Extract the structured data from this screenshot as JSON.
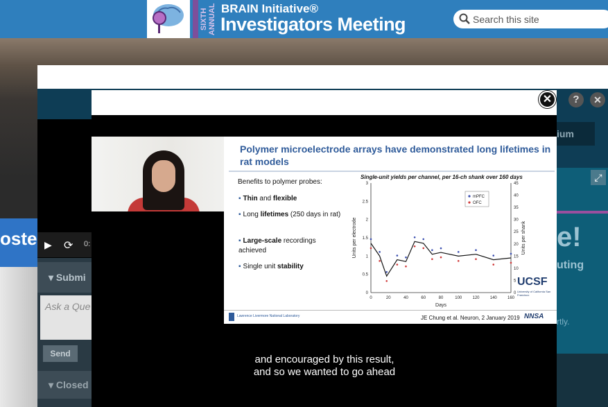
{
  "header": {
    "logo_year": "SIXTH ANNUAL",
    "logo_top": "BRAIN Initiative®",
    "logo_main": "Investigators Meeting",
    "search_placeholder": "Search this site"
  },
  "background": {
    "poster_sign": "oster"
  },
  "panel": {
    "time_label": "0:",
    "submit_label": "Submi",
    "ask_placeholder": "Ask a Que",
    "send_label": "Send",
    "closed_label": "Closed",
    "help_label": "?",
    "close_label": "✕",
    "right_button_label": "ium",
    "right_heading": "e!",
    "right_word": "uting",
    "right_small": "rtly.",
    "expand_label": "⤢"
  },
  "video": {
    "close_label": "✕",
    "slide": {
      "title": "Polymer microelectrode arrays have demonstrated long lifetimes in rat models",
      "benefits_title": "Benefits to polymer probes:",
      "bullets": [
        {
          "bold1": "Thin",
          "mid": " and ",
          "bold2": "flexible",
          "rest": ""
        },
        {
          "bold1": "",
          "mid": "Long ",
          "bold2": "lifetimes",
          "rest": " (250 days in rat)"
        },
        {
          "bold1": "Large-scale",
          "mid": " recordings achieved",
          "bold2": "",
          "rest": ""
        },
        {
          "bold1": "",
          "mid": "Single unit ",
          "bold2": "stability",
          "rest": ""
        }
      ],
      "ucsf_logo": "UCSF",
      "ucsf_sub": "University of California San Francisco",
      "llnl_text": "Lawrence Livermore National Laboratory",
      "citation": "JE Chung et al. Neuron, 2 January 2019",
      "nnsa": "NNSA"
    },
    "caption_line1": "and encouraged by this result,",
    "caption_line2": "and so we wanted to go ahead"
  },
  "chart_data": {
    "type": "line",
    "title": "Single-unit yields per channel, per 16-ch shank over 160 days",
    "xlabel": "Days",
    "ylabel": "Units per electrode",
    "y2label": "Units per shank",
    "xlim": [
      0,
      160
    ],
    "ylim": [
      0,
      3
    ],
    "y2lim": [
      0,
      45
    ],
    "x_ticks": [
      0,
      20,
      40,
      60,
      80,
      100,
      120,
      140,
      160
    ],
    "y_ticks": [
      0,
      0.5,
      1,
      1.5,
      2,
      2.5,
      3
    ],
    "y2_ticks": [
      0,
      5,
      10,
      15,
      20,
      25,
      30,
      35,
      40,
      45
    ],
    "legend": [
      "mPFC",
      "OFC"
    ],
    "legend_position": "top-right",
    "colors": {
      "mPFC": "#3b4fb0",
      "OFC": "#d03a3a",
      "mean": "#111111"
    },
    "mean_series": {
      "x": [
        0,
        10,
        18,
        30,
        40,
        50,
        60,
        70,
        80,
        100,
        120,
        140,
        160
      ],
      "y": [
        1.35,
        1.0,
        0.45,
        0.9,
        0.85,
        1.4,
        1.35,
        1.05,
        1.1,
        1.0,
        1.05,
        0.9,
        0.95
      ]
    }
  }
}
